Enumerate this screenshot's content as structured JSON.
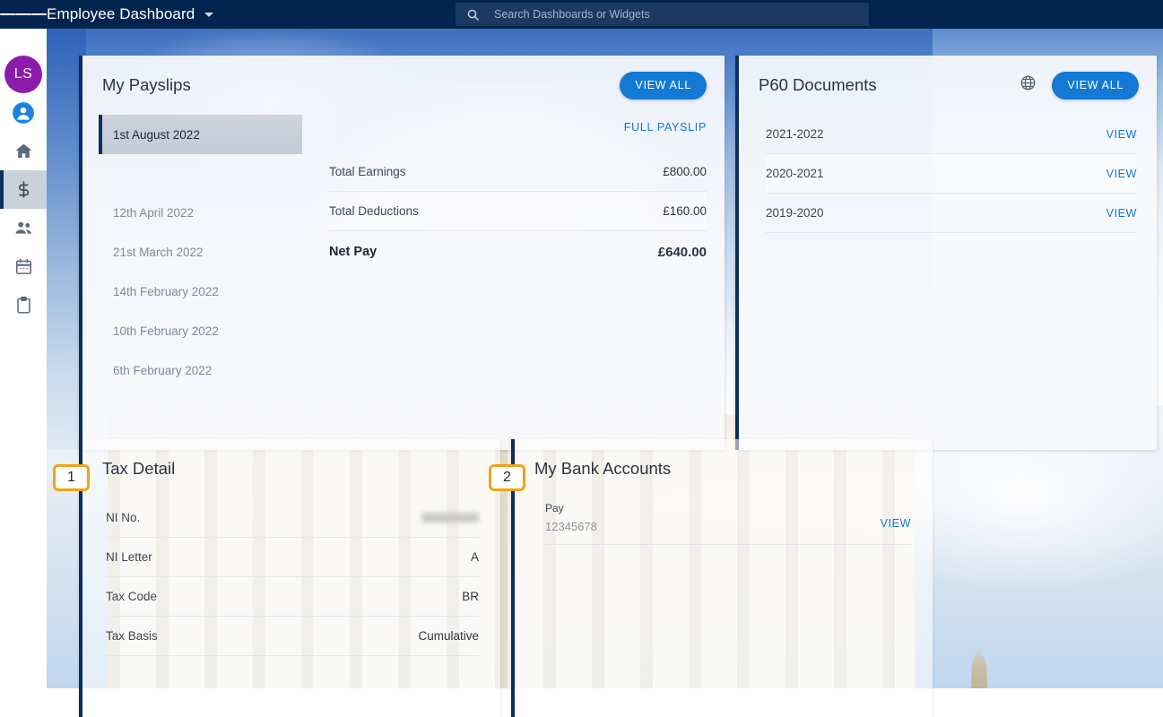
{
  "topbar": {
    "menu_icon": "hamburger-icon",
    "app_title": "Employee Dashboard",
    "caret_icon": "chevron-down-icon",
    "search": {
      "icon": "search-icon",
      "placeholder": "Search Dashboards or Widgets",
      "value": ""
    },
    "bg_color": "#00244d"
  },
  "sidebar": {
    "avatar_initials": "LS",
    "avatar_color": "#8c1aab",
    "items": [
      {
        "icon": "user-profile-icon",
        "name": "profile",
        "active": false
      },
      {
        "icon": "home-icon",
        "name": "home",
        "active": false
      },
      {
        "icon": "dollar-pay-icon",
        "name": "pay",
        "active": true
      },
      {
        "icon": "people-team-icon",
        "name": "team",
        "active": false
      },
      {
        "icon": "calendar-icon",
        "name": "calendar",
        "active": false
      },
      {
        "icon": "clipboard-icon",
        "name": "tasks",
        "active": false
      }
    ]
  },
  "payslips_card": {
    "title": "My Payslips",
    "view_all_label": "VIEW ALL",
    "full_payslip_label": "FULL PAYSLIP",
    "list": [
      {
        "date": "1st August 2022",
        "selected": true
      },
      {
        "date": "12th April 2022",
        "selected": false
      },
      {
        "date": "21st March 2022",
        "selected": false
      },
      {
        "date": "14th February 2022",
        "selected": false
      },
      {
        "date": "10th February 2022",
        "selected": false
      },
      {
        "date": "6th February 2022",
        "selected": false
      }
    ],
    "amounts": [
      {
        "label": "Total Earnings",
        "value": "£800.00"
      },
      {
        "label": "Total Deductions",
        "value": "£160.00"
      }
    ],
    "net_pay": {
      "label": "Net Pay",
      "value": "£640.00"
    }
  },
  "p60_card": {
    "title": "P60 Documents",
    "globe_icon": "globe-icon",
    "view_all_label": "VIEW ALL",
    "rows": [
      {
        "year": "2021-2022",
        "action": "VIEW"
      },
      {
        "year": "2020-2021",
        "action": "VIEW"
      },
      {
        "year": "2019-2020",
        "action": "VIEW"
      }
    ]
  },
  "tax_card": {
    "badge": "1",
    "title": "Tax Detail",
    "rows": [
      {
        "label": "NI No.",
        "value": "",
        "redacted": true
      },
      {
        "label": "NI Letter",
        "value": "A",
        "redacted": false
      },
      {
        "label": "Tax Code",
        "value": "BR",
        "redacted": false
      },
      {
        "label": "Tax Basis",
        "value": "Cumulative",
        "redacted": false
      }
    ]
  },
  "bank_card": {
    "badge": "2",
    "title": "My Bank Accounts",
    "rows": [
      {
        "name": "Pay",
        "account": "12345678",
        "action": "VIEW"
      }
    ]
  },
  "colors": {
    "topbar": "#00244d",
    "accent_blue": "#1279d4",
    "card_border": "#0d2f5c",
    "badge_border": "#f0a219",
    "avatar": "#8c1aab"
  }
}
